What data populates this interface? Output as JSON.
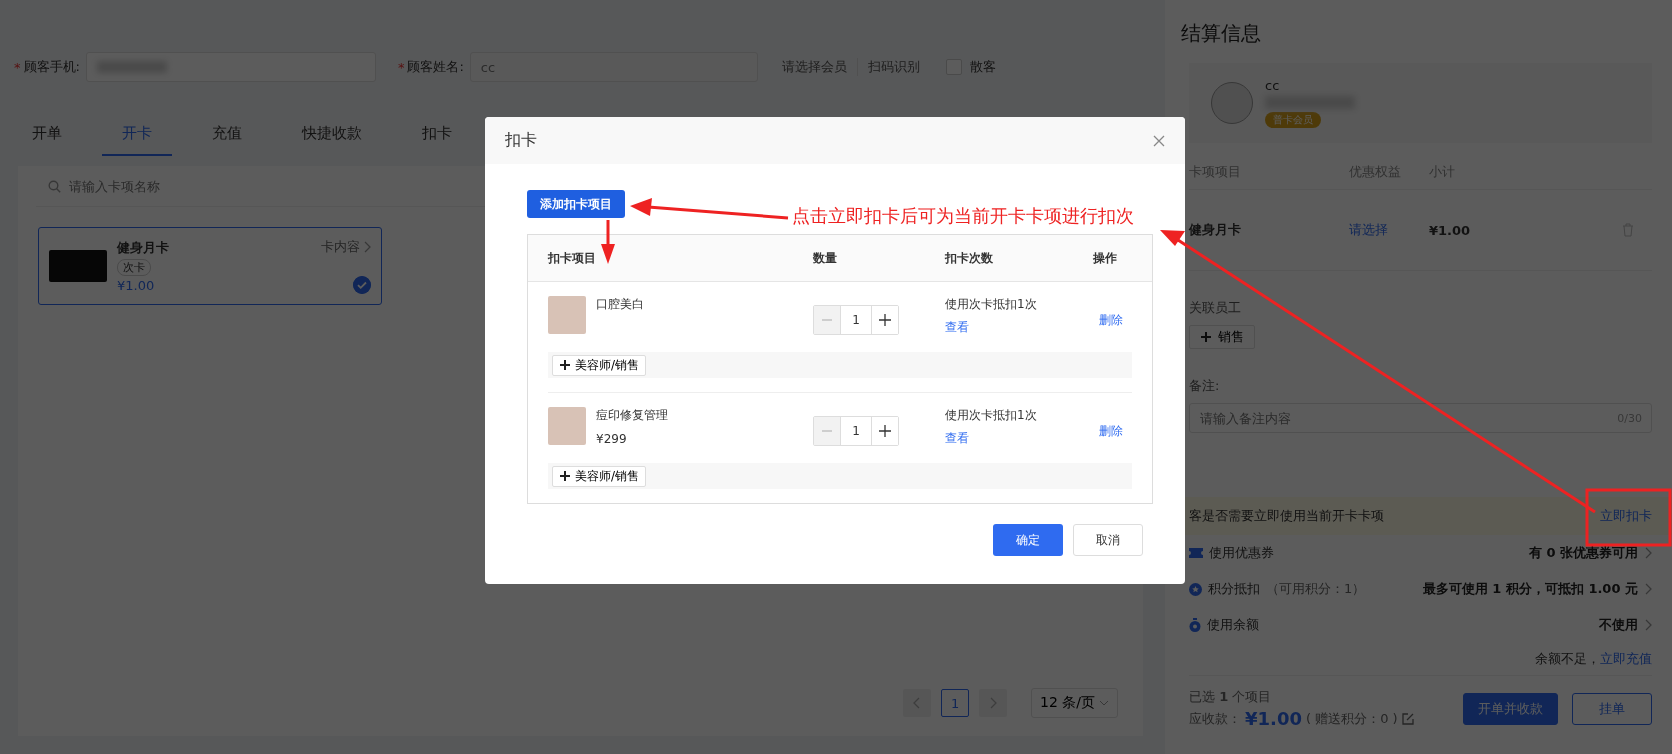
{
  "customer_form": {
    "required_mark": "*",
    "phone_label": "顾客手机:",
    "name_label": "顾客姓名:",
    "name_value": "cc",
    "links": [
      "请选择会员",
      "扫码识别"
    ],
    "walk_in": {
      "label": "散客",
      "checked": false
    }
  },
  "tabs": [
    {
      "label": "开单",
      "selected": false
    },
    {
      "label": "开卡",
      "selected": true
    },
    {
      "label": "充值",
      "selected": false
    },
    {
      "label": "快捷收款",
      "selected": false
    },
    {
      "label": "扣卡",
      "selected": false
    }
  ],
  "card_search": {
    "placeholder": "请输入卡项名称"
  },
  "cards": [
    {
      "name": "健身月卡",
      "type": "次卡",
      "price": "¥1.00",
      "link": "卡内容",
      "selected": true
    }
  ],
  "pagination": {
    "pages": [
      {
        "label": "1",
        "selected": true
      }
    ],
    "page_size": "12 条/页"
  },
  "settlement": {
    "title": "结算信息",
    "member": {
      "name": "cc",
      "badge": "普卡会员"
    },
    "columns": [
      "卡项项目",
      "优惠权益",
      "小计"
    ],
    "items": [
      {
        "name": "健身月卡",
        "discount": "请选择",
        "subtotal": "¥1.00"
      }
    ],
    "staff_label": "关联员工",
    "staff_button": "销售",
    "remark_label": "备注:",
    "remark_placeholder": "请输入备注内容",
    "remark_count": "0/30",
    "notice": "客是否需要立即使用当前开卡卡项",
    "notice_action": "立即扣卡",
    "options": [
      {
        "kind": "coupon",
        "label": "使用优惠券",
        "value": "有 0 张优惠券可用"
      },
      {
        "kind": "points",
        "label": "积分抵扣",
        "hint": "（可用积分：1）",
        "value": "最多可使用 1 积分，可抵扣 1.00 元"
      },
      {
        "kind": "balance",
        "label": "使用余额",
        "value": "不使用"
      }
    ],
    "balance_note": "余额不足，",
    "recharge_link": "立即充值",
    "selected_count": "已选 **1** 个项目",
    "amount_label": "应收款：",
    "amount": "¥1.00",
    "bonus": "( 赠送积分：0 )",
    "buttons": [
      "开单并收款",
      "挂单"
    ]
  },
  "modal": {
    "title": "扣卡",
    "add_button": "添加扣卡项目",
    "columns": [
      "扣卡项目",
      "数量",
      "扣卡次数",
      "操作"
    ],
    "rows": [
      {
        "name": "口腔美白",
        "quantity": "1",
        "deduction": "使用次卡抵扣1次",
        "view_link": "查看",
        "action": "删除",
        "staff_button": "美容师/销售"
      },
      {
        "name": "痘印修复管理",
        "price": "¥299",
        "quantity": "1",
        "deduction": "使用次卡抵扣1次",
        "view_link": "查看",
        "action": "删除",
        "staff_button": "美容师/销售"
      }
    ],
    "buttons": [
      "确定",
      "取消"
    ]
  },
  "annotation": {
    "text": "点击立即扣卡后可为当前开卡卡项进行扣次"
  }
}
